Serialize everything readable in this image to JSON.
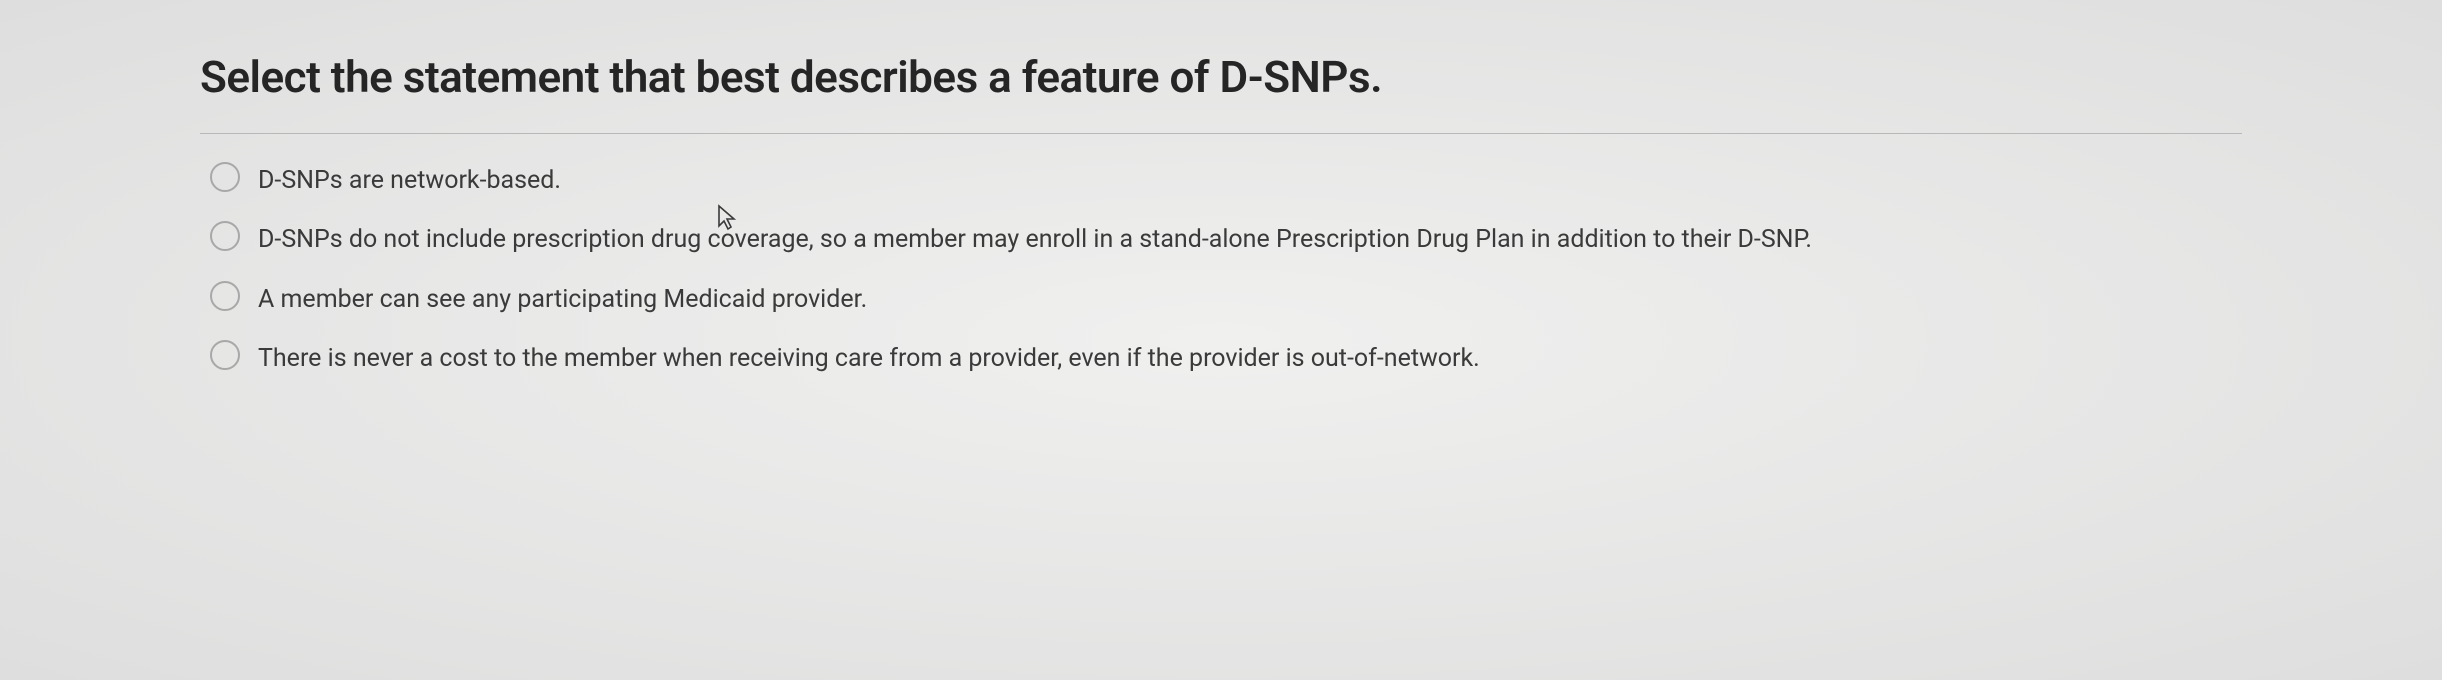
{
  "question": {
    "title": "Select the statement that best describes a feature of D-SNPs."
  },
  "options": [
    {
      "label": "D-SNPs are network-based."
    },
    {
      "label": "D-SNPs do not include prescription drug coverage, so a member may enroll in a stand-alone Prescription Drug Plan in addition to their D-SNP."
    },
    {
      "label": "A member can see any participating Medicaid provider."
    },
    {
      "label": "There is never a cost to the member when receiving care from a provider, even if the provider is out-of-network."
    }
  ]
}
